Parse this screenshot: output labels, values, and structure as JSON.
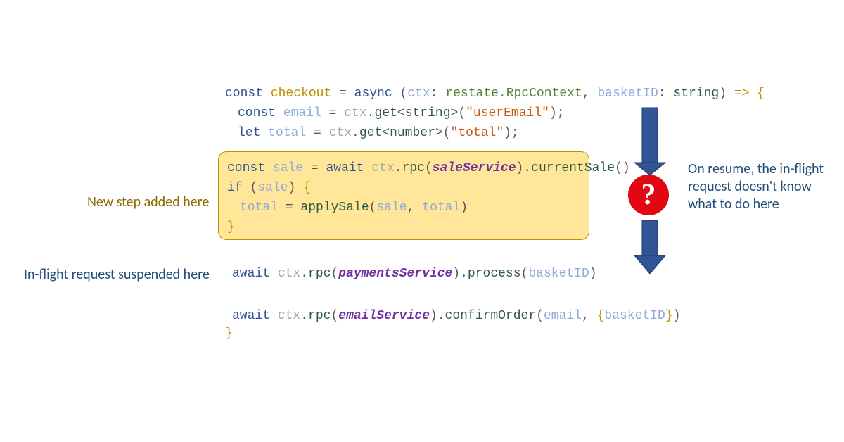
{
  "labels": {
    "newStep": "New step added here",
    "suspended": "In-flight request suspended here",
    "resume": "On resume, the in-flight request doesn't know what to do here"
  },
  "code": {
    "kw_const": "const",
    "kw_let": "let",
    "kw_async": "async",
    "kw_await": "await",
    "kw_if": "if",
    "fn_checkout": "checkout",
    "var_ctx": "ctx",
    "var_email": "email",
    "var_total": "total",
    "var_sale": "sale",
    "var_basketID": "basketID",
    "class_rpc": "restate.RpcContext",
    "type_string": "string",
    "type_number": "number",
    "lit_userEmail": "\"userEmail\"",
    "lit_total": "\"total\"",
    "m_get": "get",
    "m_rpc": "rpc",
    "m_currentSale": "currentSale",
    "m_process": "process",
    "m_confirmOrder": "confirmOrder",
    "fn_applySale": "applySale",
    "svc_sale": "saleService",
    "svc_payments": "paymentsService",
    "svc_email": "emailService",
    "arrow": " => {",
    "semi": ";",
    "dot": ".",
    "eq": " = ",
    "lp": "(",
    "rp": ")",
    "lb": "{",
    "rb": "}",
    "lt": "<",
    "gt": ">",
    "comma": ", ",
    "colon": ": ",
    "space": " "
  },
  "qmark": "?",
  "colors": {
    "arrow_fill": "#2f5597",
    "arrow_stroke": "#203864",
    "qmark_bg": "#e30613"
  }
}
